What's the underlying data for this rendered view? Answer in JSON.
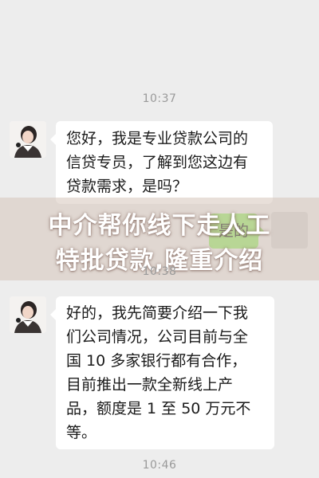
{
  "chat": {
    "timestamps": [
      "10:37",
      "10:38",
      "10:46"
    ],
    "messages": [
      {
        "sender": "agent",
        "lines": [
          "您好，我是专业贷款公司的",
          "信贷专员，了解到您这边有",
          "贷款需求，是吗？"
        ]
      },
      {
        "sender": "self",
        "text": "是的"
      },
      {
        "sender": "agent",
        "lines": [
          "好的，我先简要介绍一下我",
          "们公司情况，公司目前与全",
          "国 10 多家银行都有合作，",
          "目前推出一款全新线上产",
          "品，额度是 1 至 50 万元不",
          "等。"
        ]
      }
    ]
  },
  "overlay": {
    "lines": [
      "中介帮你线下走人工",
      "特批贷款,隆重介绍"
    ]
  },
  "colors": {
    "background": "#ededed",
    "incoming_bubble": "#ffffff",
    "outgoing_bubble": "#95ec69",
    "timestamp_text": "#9a9a9a"
  }
}
